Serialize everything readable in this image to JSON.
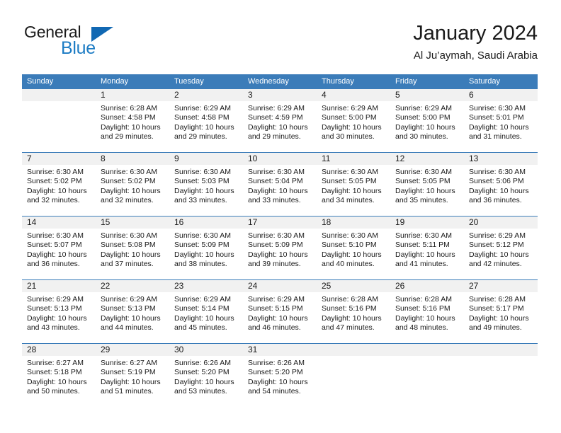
{
  "logo": {
    "word1": "General",
    "word2": "Blue",
    "triangle_color": "#1168b3",
    "blue_color": "#1d7cc4"
  },
  "header": {
    "title": "January 2024",
    "subtitle": "Al Ju’aymah, Saudi Arabia",
    "accent_color": "#3b7cb9",
    "daynum_band_color": "#f1f1f1"
  },
  "weekdays": [
    "Sunday",
    "Monday",
    "Tuesday",
    "Wednesday",
    "Thursday",
    "Friday",
    "Saturday"
  ],
  "weeks": [
    {
      "days": [
        {
          "num": "",
          "sunrise": "",
          "sunset": "",
          "daylight_1": "",
          "daylight_2": "",
          "empty": true
        },
        {
          "num": "1",
          "sunrise": "Sunrise: 6:28 AM",
          "sunset": "Sunset: 4:58 PM",
          "daylight_1": "Daylight: 10 hours",
          "daylight_2": "and 29 minutes."
        },
        {
          "num": "2",
          "sunrise": "Sunrise: 6:29 AM",
          "sunset": "Sunset: 4:58 PM",
          "daylight_1": "Daylight: 10 hours",
          "daylight_2": "and 29 minutes."
        },
        {
          "num": "3",
          "sunrise": "Sunrise: 6:29 AM",
          "sunset": "Sunset: 4:59 PM",
          "daylight_1": "Daylight: 10 hours",
          "daylight_2": "and 29 minutes."
        },
        {
          "num": "4",
          "sunrise": "Sunrise: 6:29 AM",
          "sunset": "Sunset: 5:00 PM",
          "daylight_1": "Daylight: 10 hours",
          "daylight_2": "and 30 minutes."
        },
        {
          "num": "5",
          "sunrise": "Sunrise: 6:29 AM",
          "sunset": "Sunset: 5:00 PM",
          "daylight_1": "Daylight: 10 hours",
          "daylight_2": "and 30 minutes."
        },
        {
          "num": "6",
          "sunrise": "Sunrise: 6:30 AM",
          "sunset": "Sunset: 5:01 PM",
          "daylight_1": "Daylight: 10 hours",
          "daylight_2": "and 31 minutes."
        }
      ]
    },
    {
      "days": [
        {
          "num": "7",
          "sunrise": "Sunrise: 6:30 AM",
          "sunset": "Sunset: 5:02 PM",
          "daylight_1": "Daylight: 10 hours",
          "daylight_2": "and 32 minutes."
        },
        {
          "num": "8",
          "sunrise": "Sunrise: 6:30 AM",
          "sunset": "Sunset: 5:02 PM",
          "daylight_1": "Daylight: 10 hours",
          "daylight_2": "and 32 minutes."
        },
        {
          "num": "9",
          "sunrise": "Sunrise: 6:30 AM",
          "sunset": "Sunset: 5:03 PM",
          "daylight_1": "Daylight: 10 hours",
          "daylight_2": "and 33 minutes."
        },
        {
          "num": "10",
          "sunrise": "Sunrise: 6:30 AM",
          "sunset": "Sunset: 5:04 PM",
          "daylight_1": "Daylight: 10 hours",
          "daylight_2": "and 33 minutes."
        },
        {
          "num": "11",
          "sunrise": "Sunrise: 6:30 AM",
          "sunset": "Sunset: 5:05 PM",
          "daylight_1": "Daylight: 10 hours",
          "daylight_2": "and 34 minutes."
        },
        {
          "num": "12",
          "sunrise": "Sunrise: 6:30 AM",
          "sunset": "Sunset: 5:05 PM",
          "daylight_1": "Daylight: 10 hours",
          "daylight_2": "and 35 minutes."
        },
        {
          "num": "13",
          "sunrise": "Sunrise: 6:30 AM",
          "sunset": "Sunset: 5:06 PM",
          "daylight_1": "Daylight: 10 hours",
          "daylight_2": "and 36 minutes."
        }
      ]
    },
    {
      "days": [
        {
          "num": "14",
          "sunrise": "Sunrise: 6:30 AM",
          "sunset": "Sunset: 5:07 PM",
          "daylight_1": "Daylight: 10 hours",
          "daylight_2": "and 36 minutes."
        },
        {
          "num": "15",
          "sunrise": "Sunrise: 6:30 AM",
          "sunset": "Sunset: 5:08 PM",
          "daylight_1": "Daylight: 10 hours",
          "daylight_2": "and 37 minutes."
        },
        {
          "num": "16",
          "sunrise": "Sunrise: 6:30 AM",
          "sunset": "Sunset: 5:09 PM",
          "daylight_1": "Daylight: 10 hours",
          "daylight_2": "and 38 minutes."
        },
        {
          "num": "17",
          "sunrise": "Sunrise: 6:30 AM",
          "sunset": "Sunset: 5:09 PM",
          "daylight_1": "Daylight: 10 hours",
          "daylight_2": "and 39 minutes."
        },
        {
          "num": "18",
          "sunrise": "Sunrise: 6:30 AM",
          "sunset": "Sunset: 5:10 PM",
          "daylight_1": "Daylight: 10 hours",
          "daylight_2": "and 40 minutes."
        },
        {
          "num": "19",
          "sunrise": "Sunrise: 6:30 AM",
          "sunset": "Sunset: 5:11 PM",
          "daylight_1": "Daylight: 10 hours",
          "daylight_2": "and 41 minutes."
        },
        {
          "num": "20",
          "sunrise": "Sunrise: 6:29 AM",
          "sunset": "Sunset: 5:12 PM",
          "daylight_1": "Daylight: 10 hours",
          "daylight_2": "and 42 minutes."
        }
      ]
    },
    {
      "days": [
        {
          "num": "21",
          "sunrise": "Sunrise: 6:29 AM",
          "sunset": "Sunset: 5:13 PM",
          "daylight_1": "Daylight: 10 hours",
          "daylight_2": "and 43 minutes."
        },
        {
          "num": "22",
          "sunrise": "Sunrise: 6:29 AM",
          "sunset": "Sunset: 5:13 PM",
          "daylight_1": "Daylight: 10 hours",
          "daylight_2": "and 44 minutes."
        },
        {
          "num": "23",
          "sunrise": "Sunrise: 6:29 AM",
          "sunset": "Sunset: 5:14 PM",
          "daylight_1": "Daylight: 10 hours",
          "daylight_2": "and 45 minutes."
        },
        {
          "num": "24",
          "sunrise": "Sunrise: 6:29 AM",
          "sunset": "Sunset: 5:15 PM",
          "daylight_1": "Daylight: 10 hours",
          "daylight_2": "and 46 minutes."
        },
        {
          "num": "25",
          "sunrise": "Sunrise: 6:28 AM",
          "sunset": "Sunset: 5:16 PM",
          "daylight_1": "Daylight: 10 hours",
          "daylight_2": "and 47 minutes."
        },
        {
          "num": "26",
          "sunrise": "Sunrise: 6:28 AM",
          "sunset": "Sunset: 5:16 PM",
          "daylight_1": "Daylight: 10 hours",
          "daylight_2": "and 48 minutes."
        },
        {
          "num": "27",
          "sunrise": "Sunrise: 6:28 AM",
          "sunset": "Sunset: 5:17 PM",
          "daylight_1": "Daylight: 10 hours",
          "daylight_2": "and 49 minutes."
        }
      ]
    },
    {
      "days": [
        {
          "num": "28",
          "sunrise": "Sunrise: 6:27 AM",
          "sunset": "Sunset: 5:18 PM",
          "daylight_1": "Daylight: 10 hours",
          "daylight_2": "and 50 minutes."
        },
        {
          "num": "29",
          "sunrise": "Sunrise: 6:27 AM",
          "sunset": "Sunset: 5:19 PM",
          "daylight_1": "Daylight: 10 hours",
          "daylight_2": "and 51 minutes."
        },
        {
          "num": "30",
          "sunrise": "Sunrise: 6:26 AM",
          "sunset": "Sunset: 5:20 PM",
          "daylight_1": "Daylight: 10 hours",
          "daylight_2": "and 53 minutes."
        },
        {
          "num": "31",
          "sunrise": "Sunrise: 6:26 AM",
          "sunset": "Sunset: 5:20 PM",
          "daylight_1": "Daylight: 10 hours",
          "daylight_2": "and 54 minutes."
        },
        {
          "num": "",
          "sunrise": "",
          "sunset": "",
          "daylight_1": "",
          "daylight_2": "",
          "empty": true
        },
        {
          "num": "",
          "sunrise": "",
          "sunset": "",
          "daylight_1": "",
          "daylight_2": "",
          "empty": true
        },
        {
          "num": "",
          "sunrise": "",
          "sunset": "",
          "daylight_1": "",
          "daylight_2": "",
          "empty": true
        }
      ]
    }
  ]
}
